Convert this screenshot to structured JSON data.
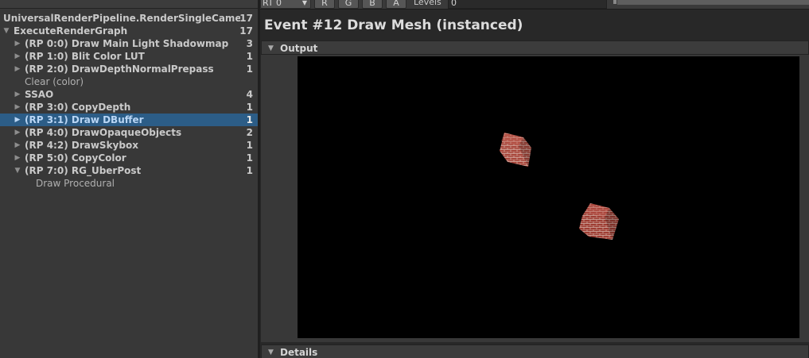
{
  "hierarchy": {
    "rows": [
      {
        "label": "UniversalRenderPipeline.RenderSingleCameraInterr",
        "count": "17",
        "arrow": "",
        "bold": true
      },
      {
        "label": "ExecuteRenderGraph",
        "count": "17",
        "arrow": "▼",
        "bold": true
      },
      {
        "label": "(RP 0:0) Draw Main Light Shadowmap",
        "count": "3",
        "arrow": "▶",
        "bold": true
      },
      {
        "label": "(RP 1:0) Blit Color LUT",
        "count": "1",
        "arrow": "▶",
        "bold": true
      },
      {
        "label": "(RP 2:0) DrawDepthNormalPrepass",
        "count": "1",
        "arrow": "▶",
        "bold": true
      },
      {
        "label": "Clear (color)",
        "count": "",
        "arrow": "",
        "bold": false
      },
      {
        "label": "SSAO",
        "count": "4",
        "arrow": "▶",
        "bold": true
      },
      {
        "label": "(RP 3:0) CopyDepth",
        "count": "1",
        "arrow": "▶",
        "bold": true
      },
      {
        "label": "(RP 3:1) Draw DBuffer",
        "count": "1",
        "arrow": "▶",
        "bold": true
      },
      {
        "label": "(RP 4:0) DrawOpaqueObjects",
        "count": "2",
        "arrow": "▶",
        "bold": true
      },
      {
        "label": "(RP 4:2) DrawSkybox",
        "count": "1",
        "arrow": "▶",
        "bold": true
      },
      {
        "label": "(RP 5:0) CopyColor",
        "count": "1",
        "arrow": "▶",
        "bold": true
      },
      {
        "label": "(RP 7:0) RG_UberPost",
        "count": "1",
        "arrow": "▼",
        "bold": true
      },
      {
        "label": "Draw Procedural",
        "count": "",
        "arrow": "",
        "bold": false
      }
    ],
    "selected_label": "(RP 3:1) Draw DBuffer"
  },
  "toolbar": {
    "render_target": "RT 0",
    "channels": [
      "R",
      "G",
      "B",
      "A"
    ],
    "levels_label": "Levels",
    "levels_value": "0"
  },
  "event": {
    "title": "Event #12 Draw Mesh (instanced)"
  },
  "sections": {
    "output": "Output",
    "details": "Details"
  },
  "icons": {
    "expanded": "triangle-down-icon",
    "collapsed": "triangle-right-icon"
  },
  "colors": {
    "selection": "#2c5d87",
    "viewport_background": "#000000",
    "brick": "#9b3a2e"
  }
}
